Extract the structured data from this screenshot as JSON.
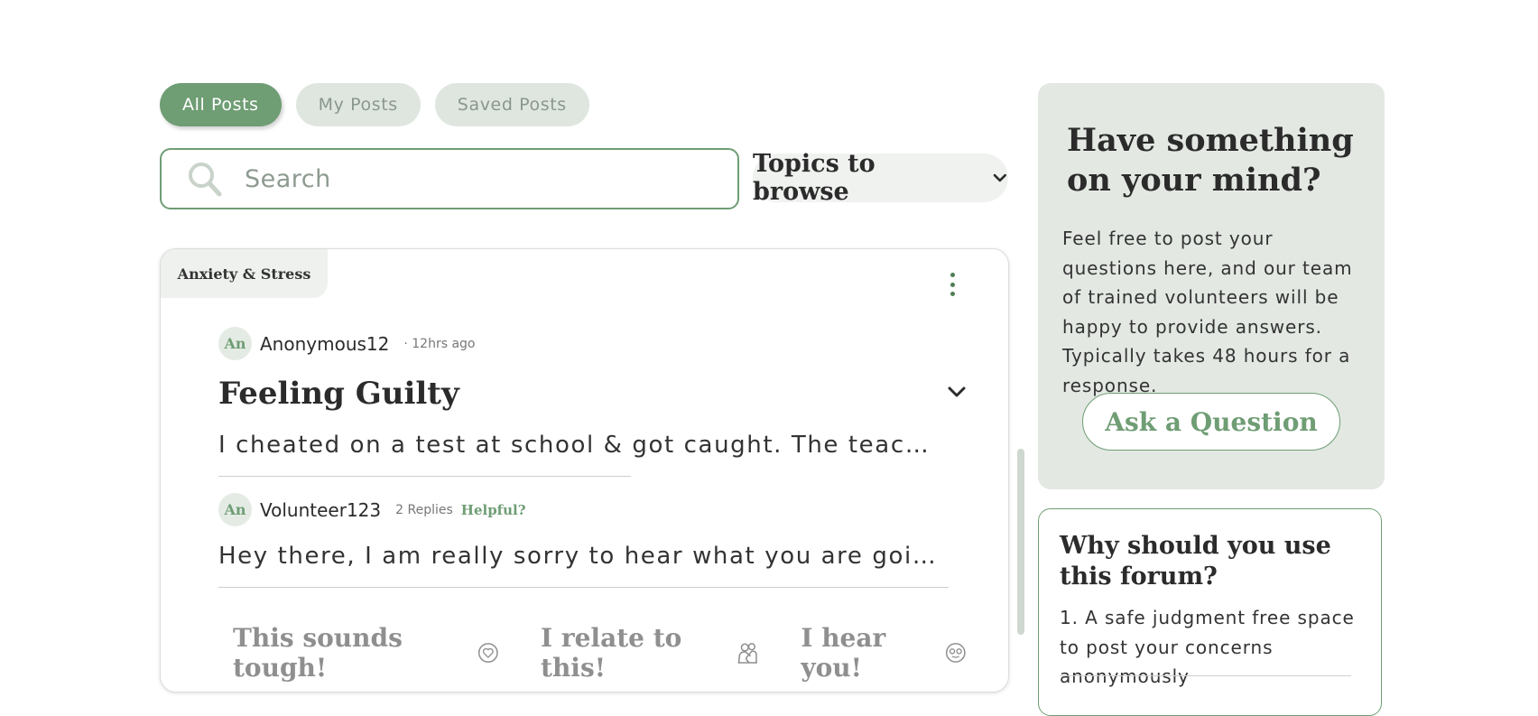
{
  "tabs": [
    {
      "label": "All Posts",
      "active": true
    },
    {
      "label": "My Posts",
      "active": false
    },
    {
      "label": "Saved Posts",
      "active": false
    }
  ],
  "search": {
    "placeholder": "Search",
    "icon": "search-icon"
  },
  "topics_dropdown": {
    "label": "Topics to browse",
    "icon": "chevron-down-icon"
  },
  "post": {
    "topic": "Anxiety & Stress",
    "author": {
      "initials": "An",
      "name": "Anonymous12",
      "time": "· 12hrs ago"
    },
    "title": "Feeling Guilty",
    "body": "I cheated on a test at school & got caught. The teacher cancelled my paper and told my parents about it",
    "reply": {
      "initials": "An",
      "name": "Volunteer123",
      "replies": "2 Replies",
      "helpful": "Helpful?",
      "body": "Hey there, I am really sorry to hear what you are going through. It must be really hard for you"
    },
    "reactions": [
      {
        "label": "This sounds tough!",
        "icon": "heart-icon"
      },
      {
        "label": "I relate to this!",
        "icon": "hug-icon"
      },
      {
        "label": "I hear you!",
        "icon": "face-icon"
      }
    ]
  },
  "sidebar": {
    "ask": {
      "title": "Have something on your mind?",
      "text": "Feel free to post your questions here, and our team of trained volunteers will be happy to provide answers. Typically takes 48 hours for a response.",
      "button": "Ask a Question"
    },
    "why": {
      "title": "Why should you use this forum?",
      "point1": "1. A safe judgment free space to post your concerns anonymously"
    }
  },
  "colors": {
    "accent": "#6f9d74",
    "panel": "#e3e8e3",
    "tab_inactive": "#dfe6df"
  }
}
